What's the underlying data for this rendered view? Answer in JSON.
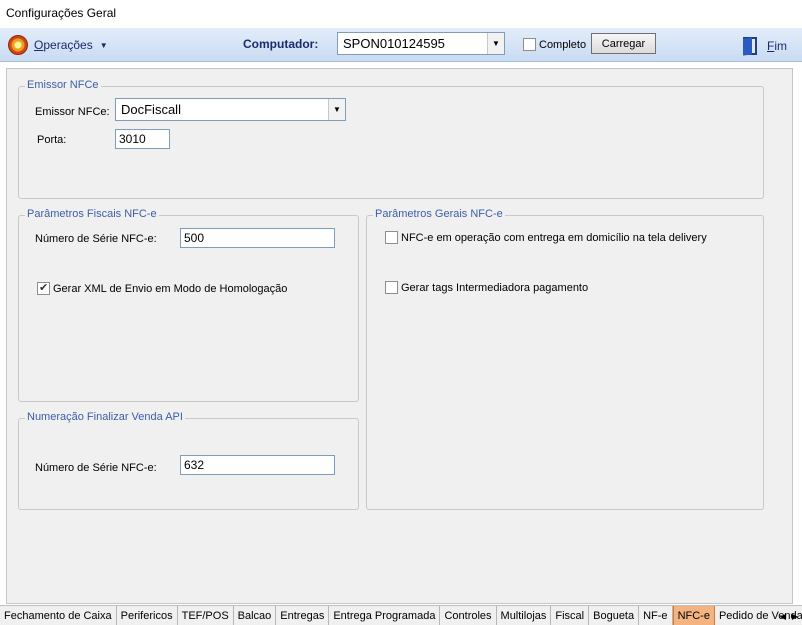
{
  "window": {
    "title": "Configurações Geral"
  },
  "toolbar": {
    "operacoes_u": "O",
    "operacoes_rest": "perações",
    "computador_label": "Computador:",
    "computador_value": "SPON010124595",
    "completo_label": "Completo",
    "completo_checked": false,
    "carregar_label": "Carregar",
    "fim_u": "F",
    "fim_rest": "im"
  },
  "emissor_group": {
    "legend": "Emissor NFCe",
    "emissor_label": "Emissor NFCe:",
    "emissor_value": "DocFiscall",
    "porta_label": "Porta:",
    "porta_value": "3010"
  },
  "fiscais_group": {
    "legend": "Parâmetros Fiscais NFC-e",
    "serie_label": "Número de Série NFC-e:",
    "serie_value": "500",
    "xml_label": "Gerar XML de Envio em Modo de Homologação",
    "xml_checked": true
  },
  "gerais_group": {
    "legend": "Parâmetros Gerais NFC-e",
    "delivery_label": "NFC-e em operação com entrega em domicílio na tela delivery",
    "delivery_checked": false,
    "intermediadora_label": "Gerar tags Intermediadora pagamento",
    "intermediadora_checked": false
  },
  "api_group": {
    "legend": "Numeração Finalizar Venda API",
    "serie_label": "Número de Série NFC-e:",
    "serie_value": "632"
  },
  "tabs": [
    "Fechamento de Caixa",
    "Perifericos",
    "TEF/POS",
    "Balcao",
    "Entregas",
    "Entrega Programada",
    "Controles",
    "Multilojas",
    "Fiscal",
    "Bogueta",
    "NF-e",
    "NFC-e",
    "Pedido de Venda"
  ],
  "active_tab": "NFC-e"
}
